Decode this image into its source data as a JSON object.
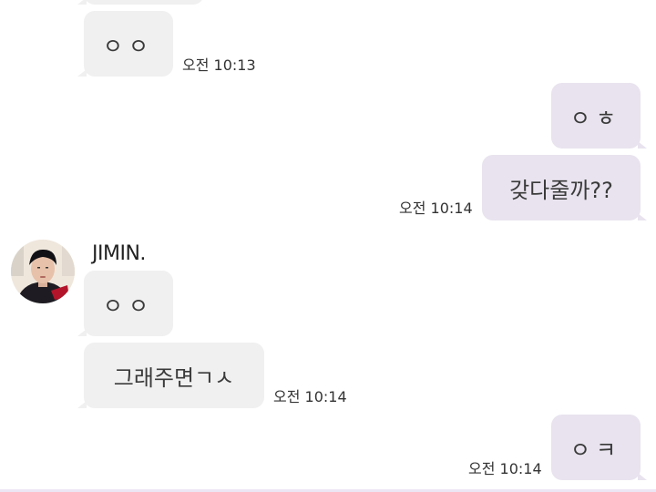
{
  "conversation": {
    "contact": {
      "name": "JIMIN."
    },
    "messages": [
      {
        "direction": "in",
        "text": "ㅇㅇ",
        "time": "오전 10:13"
      },
      {
        "direction": "out",
        "text": "ㅇㅎ",
        "time": ""
      },
      {
        "direction": "out",
        "text": "갖다줄까??",
        "time": "오전 10:14"
      },
      {
        "direction": "in",
        "text": "ㅇㅇ",
        "time": ""
      },
      {
        "direction": "in",
        "text": "그래주면ㄱㅅ",
        "time": "오전 10:14"
      },
      {
        "direction": "out",
        "text": "ㅇㅋ",
        "time": "오전 10:14"
      }
    ]
  },
  "colors": {
    "incoming_bubble": "#f0f0f0",
    "outgoing_bubble": "#e8e3ee",
    "background": "#ffffff"
  }
}
